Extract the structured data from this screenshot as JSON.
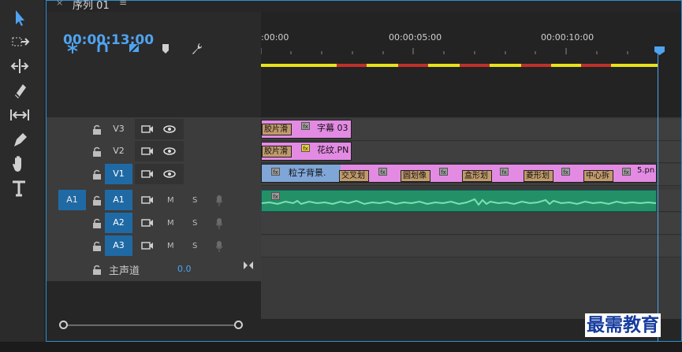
{
  "sequence_tab": {
    "close": "×",
    "title": "序列 01",
    "menu": "≡"
  },
  "timecode": "00:00:13:00",
  "header_tools": [
    "snap-icon",
    "linked-selection-icon",
    "add-marker-clip-icon",
    "marker-icon",
    "wrench-icon"
  ],
  "toolbar": [
    "selection-tool",
    "track-select-tool",
    "ripple-edit-tool",
    "razor-tool",
    "slip-tool",
    "pen-tool",
    "hand-tool",
    "type-tool"
  ],
  "ruler": {
    "labels": [
      ":00:00",
      "00:00:05:00",
      "00:00:10:00"
    ]
  },
  "colors": {
    "accent": "#4fa3f0",
    "track_target": "#1f6aa5",
    "video_clip": "#e38be3",
    "audio_clip": "#249068",
    "work_yellow": "#e7e21b",
    "work_red": "#c0312b"
  },
  "tracks": {
    "video": [
      {
        "label": "V3"
      },
      {
        "label": "V2"
      },
      {
        "label": "V1",
        "targeted": true
      }
    ],
    "audio": [
      {
        "source": "A1",
        "label": "A1",
        "m": "M",
        "s": "S"
      },
      {
        "label": "A2",
        "m": "M",
        "s": "S"
      },
      {
        "label": "A3",
        "m": "M",
        "s": "S"
      }
    ],
    "master": {
      "label": "主声道",
      "value": "0.0"
    }
  },
  "clips": {
    "v3": {
      "trans": "胶片滑",
      "name": "字幕 03",
      "fx": "fx"
    },
    "v2": {
      "trans": "胶片滑",
      "name": "花纹.PN",
      "fx": "fx"
    },
    "v1": {
      "name": "粒子背景.",
      "fx": "fx",
      "transitions": [
        "交叉划",
        "圆划像",
        "盒形划",
        "菱形划",
        "中心拆"
      ],
      "tail": "5.pn"
    },
    "a1": {
      "fx": "fx"
    }
  },
  "watermark": "最需教育"
}
